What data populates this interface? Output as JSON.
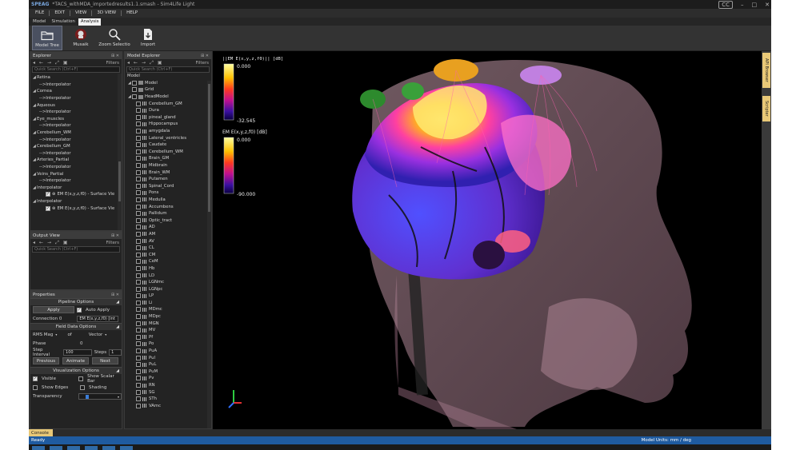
{
  "window": {
    "app_logo": "SPEAG",
    "title": "*TACS_withMDA_importedresults1.1.smash - Sim4Life Light",
    "cc_badge": "CC",
    "minimize": "–",
    "maximize": "□",
    "close": "✕"
  },
  "menu": [
    "FILE",
    "EDIT",
    "VIEW",
    "3D VIEW",
    "HELP"
  ],
  "tabs": [
    "Model",
    "Simulation",
    "Analysis"
  ],
  "active_tab": "Analysis",
  "ribbon": [
    {
      "label": "Model Tree",
      "icon": "folder-icon"
    },
    {
      "label": "Musaik",
      "icon": "musaik-icon"
    },
    {
      "label": "Zoom Selectio",
      "icon": "zoom-icon"
    },
    {
      "label": "Import",
      "icon": "import-icon"
    }
  ],
  "explorer": {
    "title": "Explorer",
    "filters": "Filters",
    "search_placeholder": "Quick Search (Ctrl+F)",
    "items": [
      {
        "label": "Retina",
        "level": 0
      },
      {
        "label": "-->Interpolator",
        "level": 1
      },
      {
        "label": "Cornea",
        "level": 0
      },
      {
        "label": "-->Interpolator",
        "level": 1
      },
      {
        "label": "Aqueous",
        "level": 0
      },
      {
        "label": "-->Interpolator",
        "level": 1
      },
      {
        "label": "Eye_muscles",
        "level": 0
      },
      {
        "label": "-->Interpolator",
        "level": 1
      },
      {
        "label": "Cerebellum_WM",
        "level": 0
      },
      {
        "label": "-->Interpolator",
        "level": 1
      },
      {
        "label": "Cerebellum_GM",
        "level": 0
      },
      {
        "label": "-->Interpolator",
        "level": 1
      },
      {
        "label": "Arteries_Partial",
        "level": 0
      },
      {
        "label": "-->Interpolator",
        "level": 1
      },
      {
        "label": "Veins_Partial",
        "level": 0
      },
      {
        "label": "-->Interpolator",
        "level": 1
      },
      {
        "label": "Interpolator",
        "level": 0
      },
      {
        "label": "EM  E(x,y,z,f0) - Surface Vie",
        "level": 2
      },
      {
        "label": "Interpolator",
        "level": 0
      },
      {
        "label": "EM  E(x,y,z,f0) - Surface Vie",
        "level": 2
      }
    ]
  },
  "output_view": {
    "title": "Output View",
    "filters": "Filters",
    "search_placeholder": "Quick Search (Ctrl+F)"
  },
  "properties": {
    "title": "Properties",
    "pipeline_options": "Pipeline Options",
    "apply": "Apply",
    "auto_apply": "Auto Apply",
    "connection_label": "Connection 0",
    "connection_value": "EM  E(x,y,z,f0) [int",
    "field_data_options": "Field Data Options",
    "rms_mag": "RMS Mag",
    "of": "of",
    "vector": "Vector",
    "phase_label": "Phase",
    "phase_value": "0",
    "step_interval_label": "Step Interval",
    "step_interval_value": "100",
    "steps_label": "Steps",
    "steps_value": "1",
    "previous": "Previous",
    "animate": "Animate",
    "next": "Next",
    "visualization_options": "Visualization Options",
    "visible": "Visible",
    "show_scalar_bar": "Show Scalar Bar",
    "show_edges": "Show Edges",
    "shading": "Shading",
    "transparency": "Transparency"
  },
  "model_explorer": {
    "title": "Model Explorer",
    "filters": "Filters",
    "search_placeholder": "Quick Search (Ctrl+F)",
    "root": "Model",
    "items": [
      "Model",
      "Grid",
      "HeadModel",
      "Cerebellum_GM",
      "Dura",
      "pineal_gland",
      "Hippocampus",
      "amygdala",
      "Lateral_ventricles",
      "Caudate",
      "Cerebellum_WM",
      "Brain_GM",
      "Midbrain",
      "Brain_WM",
      "Putamen",
      "Spinal_Cord",
      "Pons",
      "Medulla",
      "Accumbens",
      "Pallidum",
      "Optic_tract",
      "AD",
      "AM",
      "AV",
      "CL",
      "CM",
      "CeM",
      "Hb",
      "LD",
      "LGNmc",
      "LGNpc",
      "LP",
      "Li",
      "MDmc",
      "MDpc",
      "MGN",
      "MV",
      "Pf",
      "Po",
      "PuA",
      "PuI",
      "PuL",
      "PuM",
      "Pv",
      "RN",
      "SG",
      "STh",
      "VAmc"
    ]
  },
  "colorbars": [
    {
      "title": "||EM E(x,y,z,f0)|| [dB]",
      "max": "0.000",
      "min": "-32.545"
    },
    {
      "title": "EM E(x,y,z,f0) [dB]",
      "max": "0.000",
      "min": "-90.000"
    }
  ],
  "right_tabs": [
    "API Browser",
    "Scripter"
  ],
  "console": "Console",
  "status": {
    "left": "Ready",
    "right": "Model Units: mm / deg"
  },
  "colors": {
    "accent": "#1f5ba0",
    "tab_yellow": "#e8c877"
  }
}
